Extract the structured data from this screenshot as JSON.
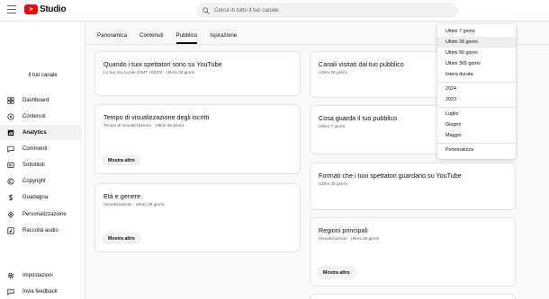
{
  "app": {
    "logo_text": "Studio"
  },
  "search": {
    "placeholder": "Cerca in tutto il tuo canale"
  },
  "sidebar": {
    "channel_label": "Il tuo canale",
    "items": [
      {
        "label": "Dashboard",
        "icon": "dashboard-icon"
      },
      {
        "label": "Contenuti",
        "icon": "content-icon"
      },
      {
        "label": "Analytics",
        "icon": "analytics-icon",
        "active": true
      },
      {
        "label": "Commenti",
        "icon": "comments-icon"
      },
      {
        "label": "Sottotitoli",
        "icon": "subtitles-icon"
      },
      {
        "label": "Copyright",
        "icon": "copyright-icon"
      },
      {
        "label": "Guadagna",
        "icon": "earn-icon"
      },
      {
        "label": "Personalizzazione",
        "icon": "customization-icon"
      },
      {
        "label": "Raccolta audio",
        "icon": "audio-library-icon"
      }
    ],
    "bottom_items": [
      {
        "label": "Impostazioni",
        "icon": "gear-icon"
      },
      {
        "label": "Invia feedback",
        "icon": "feedback-icon"
      }
    ]
  },
  "tabs": [
    {
      "label": "Panoramica"
    },
    {
      "label": "Contenuti"
    },
    {
      "label": "Pubblico",
      "active": true
    },
    {
      "label": "Ispirazione"
    }
  ],
  "cards": {
    "when_online": {
      "title": "Quando i tuoi spettatori sono su YouTube",
      "subtitle": "Lo tuo ora locale (GMT +0200) · Ultimi 28 giorni"
    },
    "watch_time_subs": {
      "title": "Tempo di visualizzazione degli iscritti",
      "subtitle": "Tempo di visualizzazione · Ultimi 28 giorni",
      "button": "Mostra altro"
    },
    "age_gender": {
      "title": "Età e genere",
      "subtitle": "Visualizzazioni · Ultimi 28 giorni",
      "button": "Mostra altro"
    },
    "channels_visited": {
      "title": "Canali visitati dal tuo pubblico",
      "subtitle": "Ultimi 28 giorni"
    },
    "what_audience_watches": {
      "title": "Cosa guarda il tuo pubblico",
      "subtitle": "Ultimi 7 giorni"
    },
    "formats": {
      "title": "Formati che i tuoi spettatori guardano su YouTube",
      "subtitle": "Ultimi 28 giorni"
    },
    "regions": {
      "title": "Regioni principali",
      "subtitle": "Visualizzazioni · Ultimi 28 giorni",
      "button": "Mostra altro"
    }
  },
  "date_menu": {
    "items": [
      {
        "label": "Ultimi 7 giorni"
      },
      {
        "label": "Ultimi 28 giorni",
        "selected": true
      },
      {
        "label": "Ultimi 90 giorni"
      },
      {
        "label": "Ultimi 365 giorni"
      },
      {
        "label": "Intera durata"
      },
      {
        "label": "2024"
      },
      {
        "label": "2023"
      },
      {
        "label": "Luglio"
      },
      {
        "label": "Giugno"
      },
      {
        "label": "Maggio"
      },
      {
        "label": "Personalizza"
      }
    ]
  },
  "colors": {
    "brand_red": "#ff0000",
    "selected_bg": "#efefef"
  }
}
